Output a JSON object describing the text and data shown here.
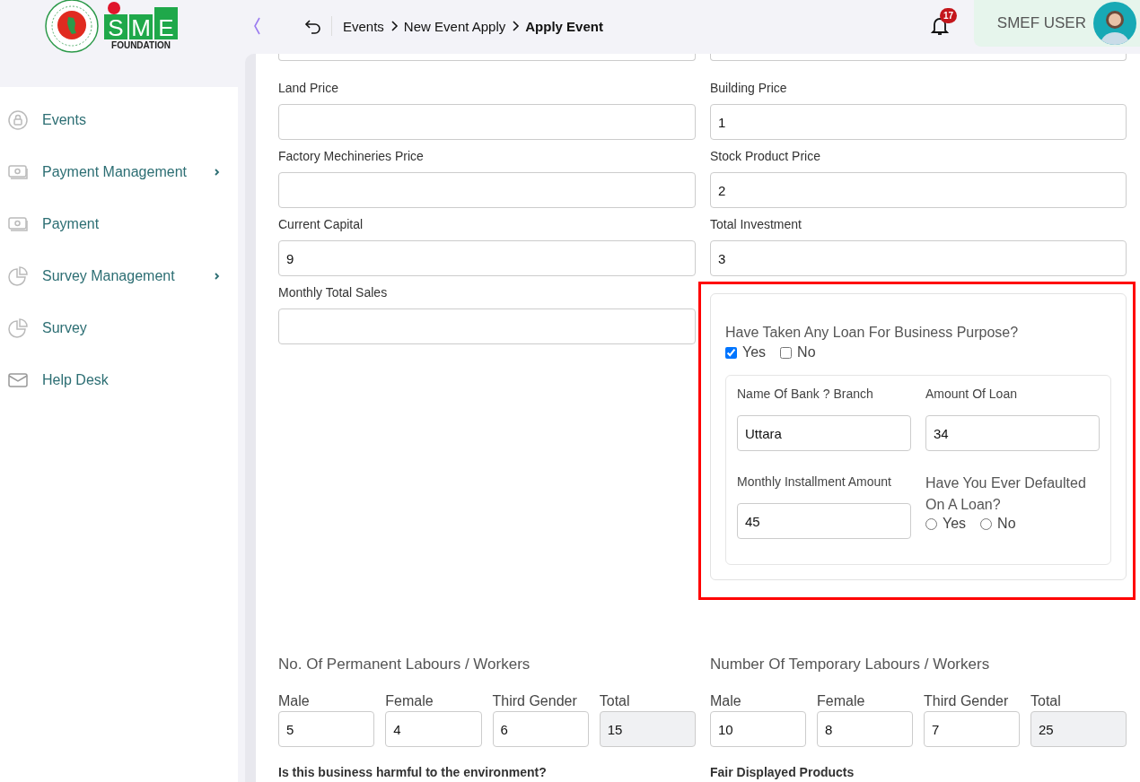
{
  "header": {
    "logo": {
      "letters": [
        "S",
        "M",
        "E"
      ],
      "subtitle": "FOUNDATION"
    },
    "breadcrumb": [
      {
        "label": "Events",
        "current": false
      },
      {
        "label": "New Event Apply",
        "current": false
      },
      {
        "label": "Apply Event",
        "current": true
      }
    ],
    "notifications": {
      "count": "17"
    },
    "user": {
      "name": "SMEF USER"
    }
  },
  "sidebar": {
    "items": [
      {
        "label": "Events",
        "kind": "lock",
        "has_submenu": false
      },
      {
        "label": "Payment Management",
        "kind": "money",
        "has_submenu": true
      },
      {
        "label": "Payment",
        "kind": "money",
        "has_submenu": false
      },
      {
        "label": "Survey Management",
        "kind": "pie",
        "has_submenu": true
      },
      {
        "label": "Survey",
        "kind": "pie",
        "has_submenu": false
      },
      {
        "label": "Help Desk",
        "kind": "mail",
        "has_submenu": false
      }
    ]
  },
  "form": {
    "fields": [
      {
        "label": "Land Price"
      },
      {
        "label": "Building Price",
        "value": "1"
      },
      {
        "label": "Factory Mechineries Price"
      },
      {
        "label": "Stock Product Price",
        "value": "2"
      },
      {
        "label": "Current Capital",
        "value": "9"
      },
      {
        "label": "Total Investment",
        "value": "3"
      },
      {
        "label": "Monthly Total Sales"
      }
    ]
  },
  "loan_section": {
    "highlighted": true,
    "question": "Have Taken Any Loan For Business Purpose?",
    "options": [
      {
        "label": "Yes",
        "checked": true
      },
      {
        "label": "No",
        "checked": false
      }
    ],
    "fields": [
      {
        "label": "Name Of Bank ? Branch",
        "value": "Uttara"
      },
      {
        "label": "Amount Of Loan",
        "value": "34"
      },
      {
        "label": "Monthly Installment Amount",
        "value": "45"
      }
    ],
    "default_question": "Have You Ever Defaulted On A Loan?",
    "default_options": [
      {
        "label": "Yes",
        "selected": false
      },
      {
        "label": "No",
        "selected": false
      }
    ]
  },
  "labour_groups": [
    {
      "title": "No. Of Permanent Labours / Workers",
      "fields": [
        {
          "label": "Male",
          "value": "5",
          "readonly": false
        },
        {
          "label": "Female",
          "value": "4",
          "readonly": false
        },
        {
          "label": "Third Gender",
          "value": "6",
          "readonly": false
        },
        {
          "label": "Total",
          "value": "15",
          "readonly": true
        }
      ]
    },
    {
      "title": "Number Of Temporary Labours / Workers",
      "fields": [
        {
          "label": "Male",
          "value": "10",
          "readonly": false
        },
        {
          "label": "Female",
          "value": "8",
          "readonly": false
        },
        {
          "label": "Third Gender",
          "value": "7",
          "readonly": false
        },
        {
          "label": "Total",
          "value": "25",
          "readonly": true
        }
      ]
    }
  ],
  "bottom_labels": [
    "Is this business harmful to the environment?",
    "Fair Displayed Products"
  ]
}
